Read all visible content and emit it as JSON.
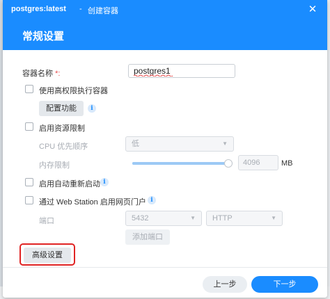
{
  "window": {
    "title": "postgres:latest",
    "separator": "-",
    "subtitle": "创建容器",
    "close_icon": "close-icon"
  },
  "section": {
    "title": "常规设置"
  },
  "form": {
    "container_name_label": "容器名称",
    "required_mark": "*:",
    "container_name_value": "postgres1",
    "high_privilege_label": "使用高权限执行容器",
    "high_privilege_checked": false,
    "configure_button": "配置功能",
    "resource_limit_label": "启用资源限制",
    "resource_limit_checked": false,
    "cpu_priority_label": "CPU 优先顺序",
    "cpu_priority_value": "低",
    "memory_limit_label": "内存限制",
    "memory_limit_value": "4096",
    "memory_limit_unit": "MB",
    "memory_slider_percent": 100,
    "auto_restart_label": "启用自动重新启动",
    "auto_restart_checked": false,
    "web_station_label": "通过 Web Station 启用网页门户",
    "web_station_checked": false,
    "port_label": "端口",
    "port_value": "5432",
    "protocol_value": "HTTP",
    "add_port_button": "添加端口",
    "advanced_button": "高级设置"
  },
  "footer": {
    "prev_button": "上一步",
    "next_button": "下一步"
  },
  "colors": {
    "accent": "#1a8cff",
    "highlight": "#e02424",
    "required": "#e64a4a"
  }
}
